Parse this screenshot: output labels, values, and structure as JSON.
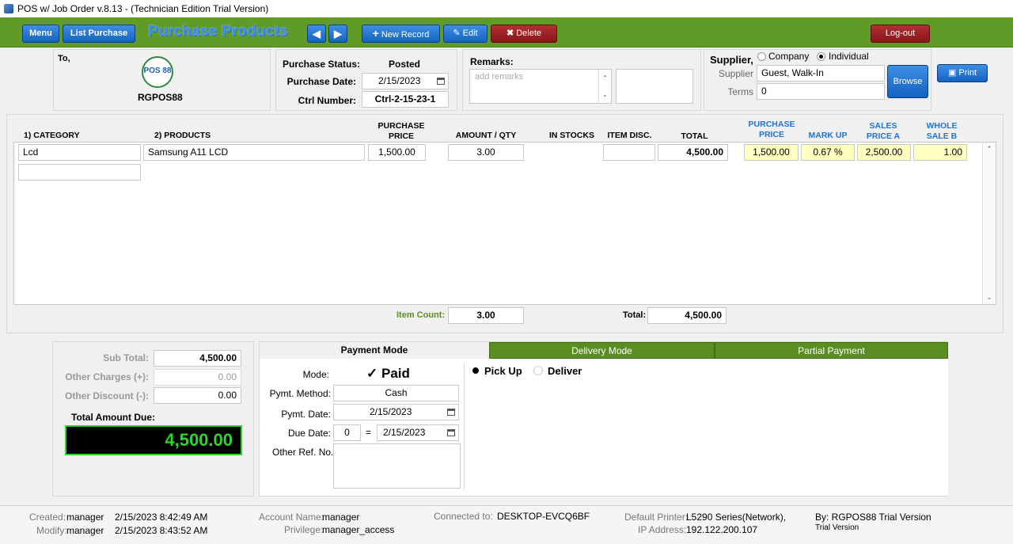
{
  "window": {
    "title": "POS w/ Job Order v.8.13 - (Technician Edition Trial Version)"
  },
  "toolbar": {
    "menu": "Menu",
    "list_purchase": "List Purchase",
    "page_title": "Purchase Products",
    "new_record": "New Record",
    "edit": "Edit",
    "delete": "Delete",
    "logout": "Log-out"
  },
  "to_panel": {
    "label": "To,",
    "logo_text": "POS 88",
    "company": "RGPOS88"
  },
  "status_panel": {
    "status_label": "Purchase Status:",
    "status_value": "Posted",
    "date_label": "Purchase Date:",
    "date_value": "2/15/2023",
    "ctrl_label": "Ctrl Number:",
    "ctrl_value": "Ctrl-2-15-23-1"
  },
  "remarks": {
    "label": "Remarks:",
    "placeholder": "add remarks"
  },
  "supplier": {
    "label": "Supplier,",
    "opt_company": "Company",
    "opt_individual": "Individual",
    "selected": "Individual",
    "supplier_label": "Supplier",
    "supplier_value": "Guest,  Walk-In",
    "terms_label": "Terms",
    "terms_value": "0",
    "browse": "Browse",
    "print": "Print"
  },
  "grid": {
    "headers": {
      "category": "1) CATEGORY",
      "products": "2) PRODUCTS",
      "purchase_price": "PURCHASE PRICE",
      "amount_qty": "AMOUNT / QTY",
      "in_stocks": "IN STOCKS",
      "item_disc": "ITEM DISC.",
      "total": "TOTAL",
      "purchase_price2": "PURCHASE PRICE",
      "mark_up": "MARK UP",
      "sales_price_a": "SALES PRICE A",
      "whole_sale_b": "WHOLE SALE B"
    },
    "row": {
      "category": "Lcd",
      "product": "Samsung A11 LCD",
      "purchase_price": "1,500.00",
      "qty": "3.00",
      "in_stocks": "",
      "item_disc": "",
      "total": "4,500.00",
      "purchase_price2": "1,500.00",
      "mark_up": "0.67 %",
      "sales_price_a": "2,500.00",
      "whole_sale_b": "1.00"
    },
    "item_count_label": "Item Count:",
    "item_count": "3.00",
    "total_label": "Total:",
    "total": "4,500.00"
  },
  "summary": {
    "subtotal_label": "Sub Total:",
    "subtotal": "4,500.00",
    "other_charges_label": "Other Charges (+):",
    "other_charges": "0.00",
    "other_discount_label": "Other Discount (-):",
    "other_discount": "0.00",
    "amount_due_label": "Total Amount Due:",
    "amount_due": "4,500.00"
  },
  "payment": {
    "tabs": [
      "Payment Mode",
      "Delivery Mode",
      "Partial Payment"
    ],
    "mode_label": "Mode:",
    "paid": "Paid",
    "method_label": "Pymt. Method:",
    "method": "Cash",
    "pymt_date_label": "Pymt. Date:",
    "pymt_date": "2/15/2023",
    "due_date_label": "Due Date:",
    "due_days": "0",
    "equals": "=",
    "due_date": "2/15/2023",
    "other_ref_label": "Other Ref. No.",
    "pickup": "Pick Up",
    "deliver": "Deliver"
  },
  "footer": {
    "created_label": "Created:",
    "created_by": "manager",
    "created_at": "2/15/2023 8:42:49 AM",
    "modify_label": "Modify:",
    "modify_by": "manager",
    "modify_at": "2/15/2023 8:43:52 AM",
    "account_label": "Account Name:",
    "account": "manager",
    "privilege_label": "Privilege:",
    "privilege": "manager_access",
    "connected_label": "Connected to:",
    "connected": "DESKTOP-EVCQ6BF",
    "printer_label": "Default Printer:",
    "printer": "L5290 Series(Network),",
    "ip_label": "IP Address:",
    "ip": "192.122.200.107",
    "by": "By: RGPOS88 Trial Version",
    "trial": "Trial Version"
  },
  "colors": {
    "toolbar": "#5f9b26",
    "title_blue": "#3a8ee8",
    "amount_green": "#2bd62b"
  }
}
